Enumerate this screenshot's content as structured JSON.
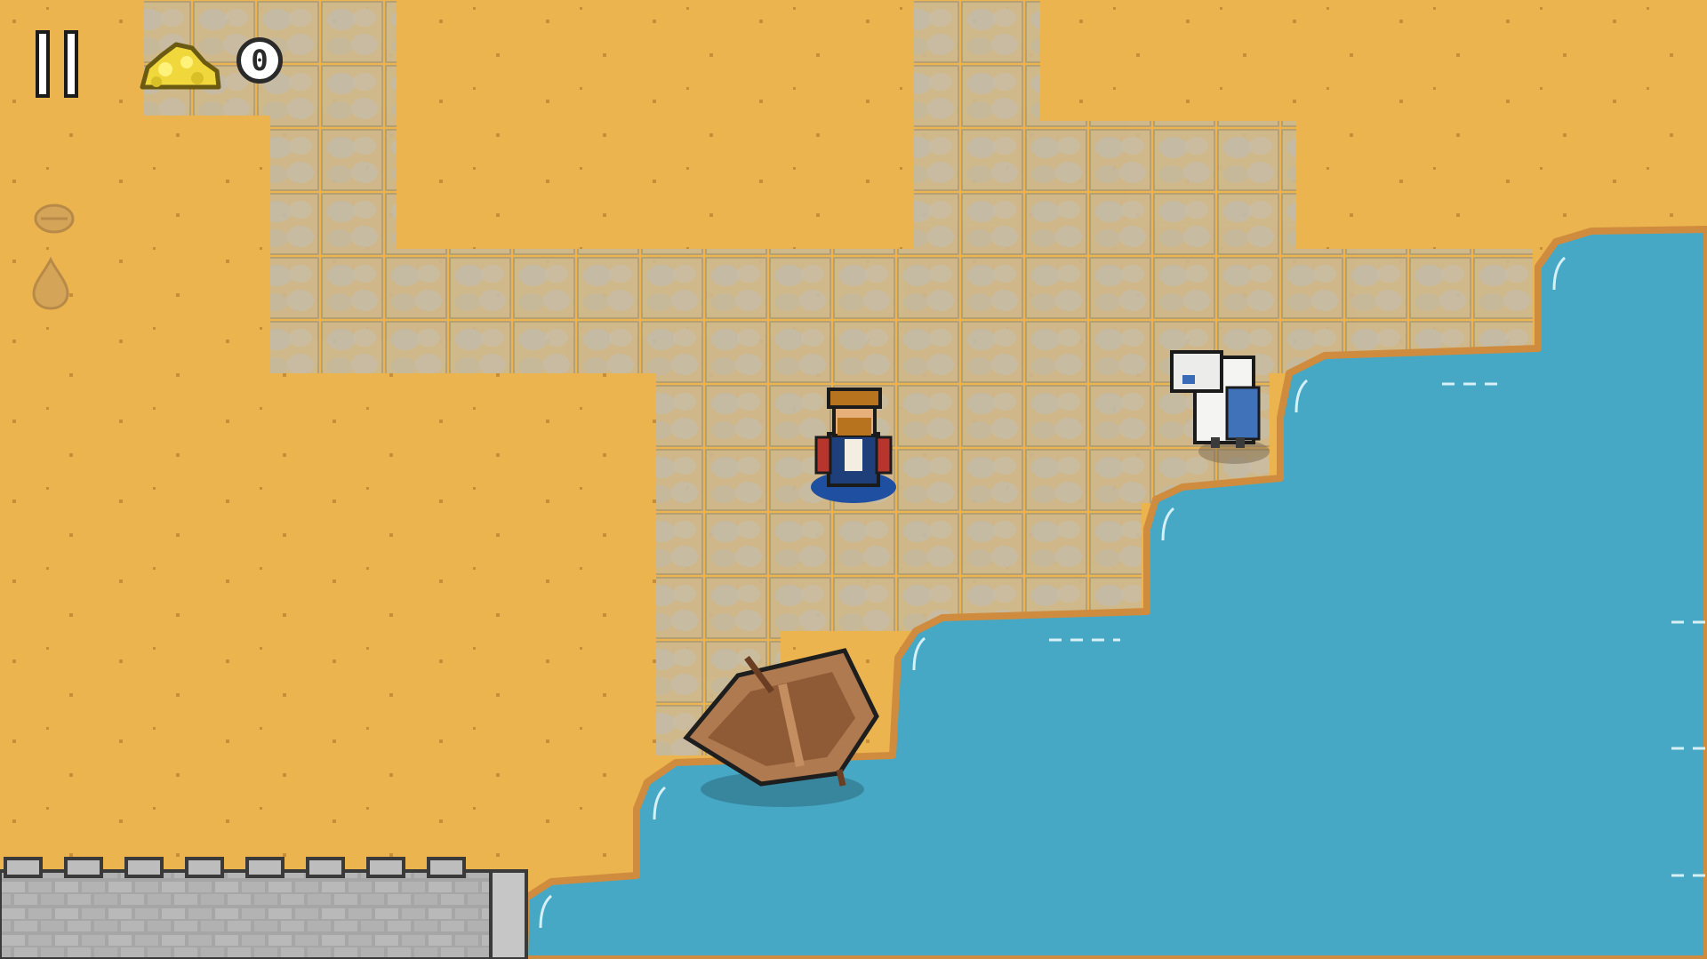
{
  "hud": {
    "gold_count": "0",
    "icons": {
      "pause": "pause-icon",
      "gold": "gold-pile-icon",
      "side_1": "seed-icon",
      "side_2": "water-drop-icon"
    }
  },
  "colors": {
    "sand": "#ebb44f",
    "water": "#46a8c4",
    "shore": "#d08c3e",
    "stone_path": "#c9b48d",
    "wall": "#a9a9a9"
  }
}
